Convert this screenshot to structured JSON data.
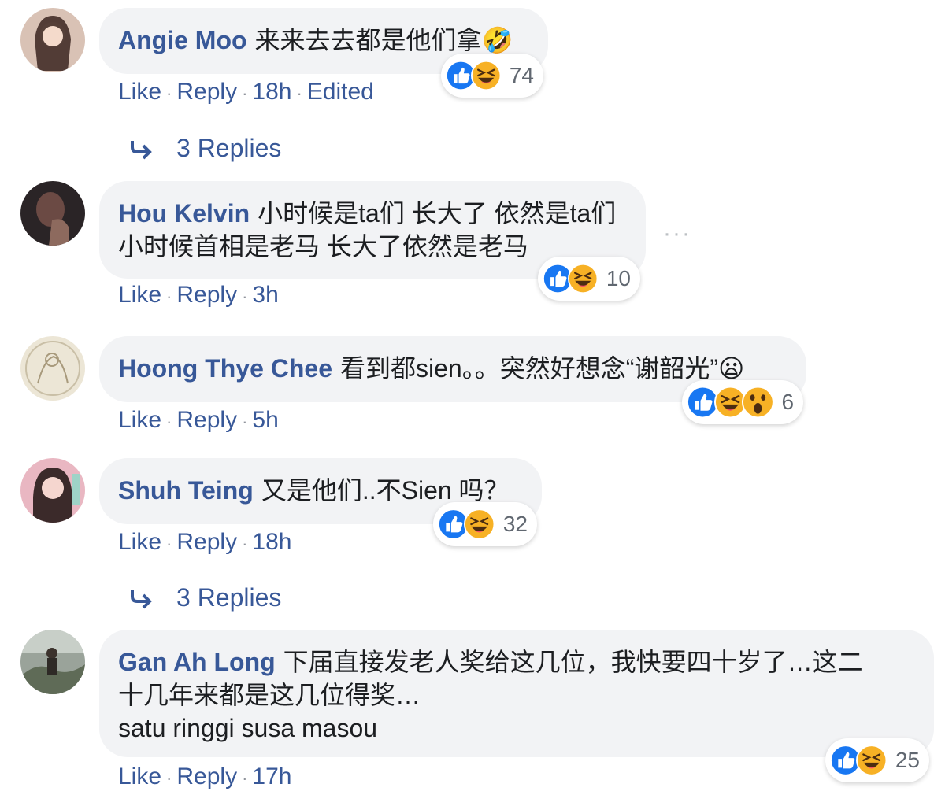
{
  "comments": [
    {
      "author": "Angie Moo",
      "text_lines": [
        "来来去去都是他们拿🤣"
      ],
      "reaction_count": "74",
      "actions": {
        "like": "Like",
        "reply": "Reply",
        "time": "18h",
        "edited": "Edited"
      },
      "replies_label": "3 Replies"
    },
    {
      "author": "Hou Kelvin",
      "text_lines": [
        "小时候是ta们 长大了 依然是ta们",
        "小时候首相是老马 长大了依然是老马"
      ],
      "reaction_count": "10",
      "actions": {
        "like": "Like",
        "reply": "Reply",
        "time": "3h"
      }
    },
    {
      "author": "Hoong Thye Chee",
      "text_lines": [
        "看到都sien。。突然好想念“谢韶光”😦"
      ],
      "reaction_count": "6",
      "actions": {
        "like": "Like",
        "reply": "Reply",
        "time": "5h"
      }
    },
    {
      "author": "Shuh Teing",
      "text_lines": [
        "又是他们..不Sien 吗？"
      ],
      "reaction_count": "32",
      "actions": {
        "like": "Like",
        "reply": "Reply",
        "time": "18h"
      },
      "replies_label": "3 Replies"
    },
    {
      "author": "Gan Ah Long",
      "text_lines": [
        "下届直接发老人奖给这几位，我快要四十岁了…这二",
        "十几年来都是这几位得奖…",
        "satu ringgi susa masou"
      ],
      "reaction_count": "25",
      "actions": {
        "like": "Like",
        "reply": "Reply",
        "time": "17h"
      }
    }
  ],
  "more_options": "···",
  "colors": {
    "link": "#385898",
    "bubble": "#f2f3f5",
    "like_blue": "#1877f2",
    "haha_yellow": "#f7b125"
  },
  "icons": {
    "like": "like-reaction-icon",
    "haha": "haha-reaction-icon",
    "wow": "wow-reaction-icon",
    "reply_arrow": "reply-arrow-icon"
  }
}
